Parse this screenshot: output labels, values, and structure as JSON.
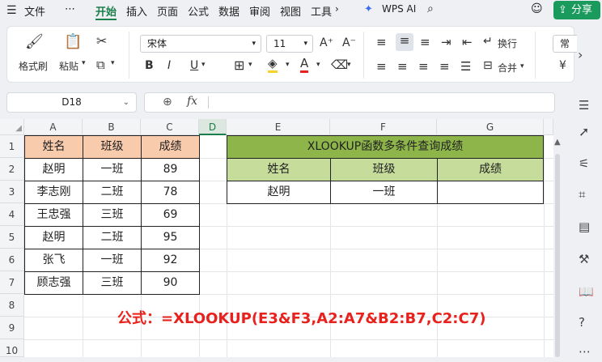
{
  "menu": {
    "file": "文件",
    "more": "⋯",
    "tabs": [
      "开始",
      "插入",
      "页面",
      "公式",
      "数据",
      "审阅",
      "视图",
      "工具"
    ],
    "wps_ai": "WPS AI",
    "share": "分享"
  },
  "ribbon": {
    "format_painter": "格式刷",
    "paste": "粘贴",
    "font_name": "宋体",
    "font_size": "11",
    "bold": "B",
    "italic": "I",
    "underline": "U",
    "wrap": "换行",
    "merge": "合并",
    "normal": "常",
    "currency": "¥",
    "font_grow": "A⁺",
    "font_shrink": "A⁻",
    "font_color": "A"
  },
  "formula_bar": {
    "name_box": "D18",
    "fx": "fx",
    "content": ""
  },
  "sheet": {
    "columns": [
      "A",
      "B",
      "C",
      "D",
      "E",
      "F",
      "G"
    ],
    "rows": [
      "1",
      "2",
      "3",
      "4",
      "5",
      "6",
      "7",
      "8",
      "9",
      "10"
    ],
    "left_table": {
      "headers": [
        "姓名",
        "班级",
        "成绩"
      ],
      "rows": [
        [
          "赵明",
          "一班",
          "89"
        ],
        [
          "李志刚",
          "二班",
          "78"
        ],
        [
          "王忠强",
          "三班",
          "69"
        ],
        [
          "赵明",
          "二班",
          "95"
        ],
        [
          "张飞",
          "一班",
          "92"
        ],
        [
          "顾志强",
          "三班",
          "90"
        ]
      ]
    },
    "right_table": {
      "title": "XLOOKUP函数多条件查询成绩",
      "headers": [
        "姓名",
        "班级",
        "成绩"
      ],
      "row": [
        "赵明",
        "一班",
        ""
      ]
    },
    "formula_note": "公式：=XLOOKUP(E3&F3,A2:A7&B2:B7,C2:C7)"
  },
  "colors": {
    "accent_green": "#1a7f4b",
    "share_bg": "#1a9a5c",
    "header_peach": "#f8cbad",
    "title_green": "#8db54a",
    "subheader_green": "#c5dc9b",
    "formula_red": "#e8211d"
  }
}
